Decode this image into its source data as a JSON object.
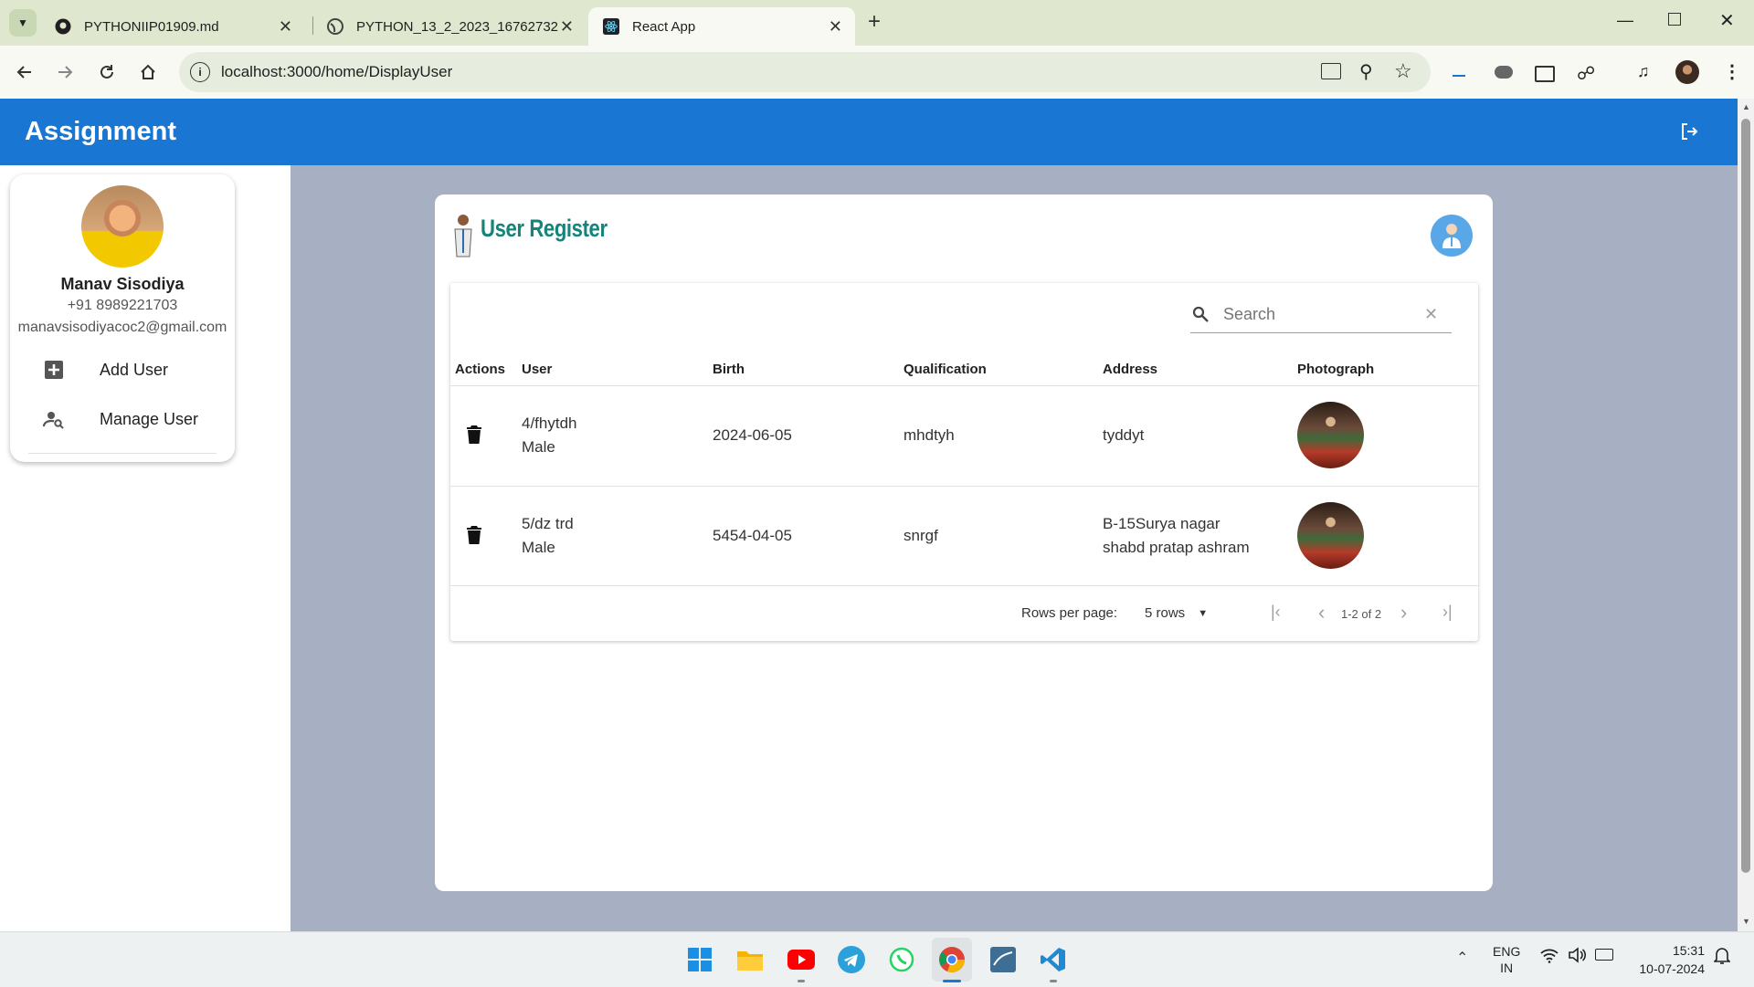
{
  "browser": {
    "tabs": [
      {
        "title": "PYTHONIIP01909.md",
        "icon": "github-icon"
      },
      {
        "title": "PYTHON_13_2_2023_16762732",
        "icon": "globe-icon"
      },
      {
        "title": "React App",
        "icon": "react-icon"
      }
    ],
    "new_tab": "+",
    "url": "localhost:3000/home/DisplayUser"
  },
  "app": {
    "title": "Assignment"
  },
  "profile": {
    "name": "Manav Sisodiya",
    "phone": "+91 8989221703",
    "email": "manavsisodiyacoc2@gmail.com"
  },
  "sidebar_menu": [
    {
      "label": "Add User",
      "icon": "add-box-icon"
    },
    {
      "label": "Manage User",
      "icon": "manage-accounts-icon"
    }
  ],
  "page": {
    "title": "User Register",
    "search_placeholder": "Search"
  },
  "table": {
    "columns": [
      "Actions",
      "User",
      "Birth",
      "Qualification",
      "Address",
      "Photograph"
    ],
    "rows": [
      {
        "user_line1": "4/fhytdh",
        "user_line2": "Male",
        "birth": "2024-06-05",
        "qualification": "mhdtyh",
        "address_line1": "tyddyt",
        "address_line2": ""
      },
      {
        "user_line1": "5/dz trd",
        "user_line2": "Male",
        "birth": "5454-04-05",
        "qualification": "snrgf",
        "address_line1": "B-15Surya nagar",
        "address_line2": "shabd pratap ashram"
      }
    ]
  },
  "pagination": {
    "rows_per_page_label": "Rows per page:",
    "rows_per_page_value": "5 rows",
    "range": "1-2 of 2"
  },
  "taskbar": {
    "lang": "ENG",
    "region": "IN",
    "time": "15:31",
    "date": "10-07-2024"
  },
  "colors": {
    "appbar": "#1976d2",
    "title_teal": "#16847a",
    "main_bg": "#a6b0c2"
  }
}
